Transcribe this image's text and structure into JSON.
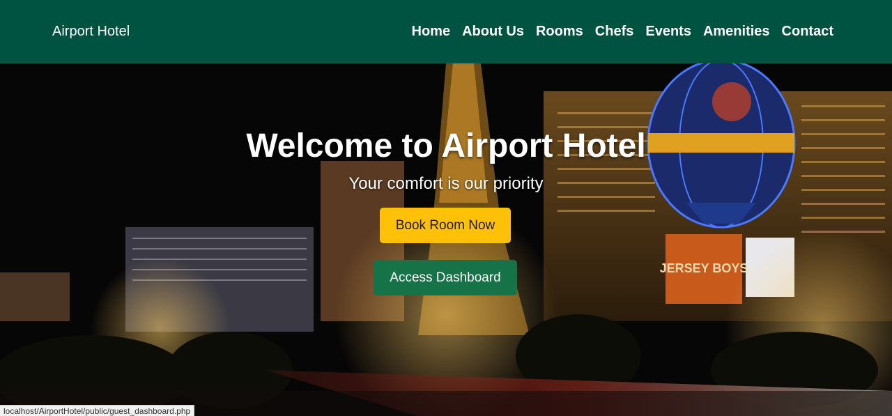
{
  "navbar": {
    "brand": "Airport Hotel",
    "links": [
      "Home",
      "About Us",
      "Rooms",
      "Chefs",
      "Events",
      "Amenities",
      "Contact"
    ]
  },
  "hero": {
    "title": "Welcome to Airport Hotel",
    "subtitle": "Your comfort is our priority",
    "book_button": "Book Room Now",
    "dashboard_button": "Access Dashboard",
    "image_sign_text": "JERSEY BOYS"
  },
  "status_bar": {
    "url": "localhost/AirportHotel/public/guest_dashboard.php"
  },
  "colors": {
    "navbar_bg": "#005340",
    "book_button_bg": "#ffc107",
    "dashboard_button_bg": "#157347"
  }
}
